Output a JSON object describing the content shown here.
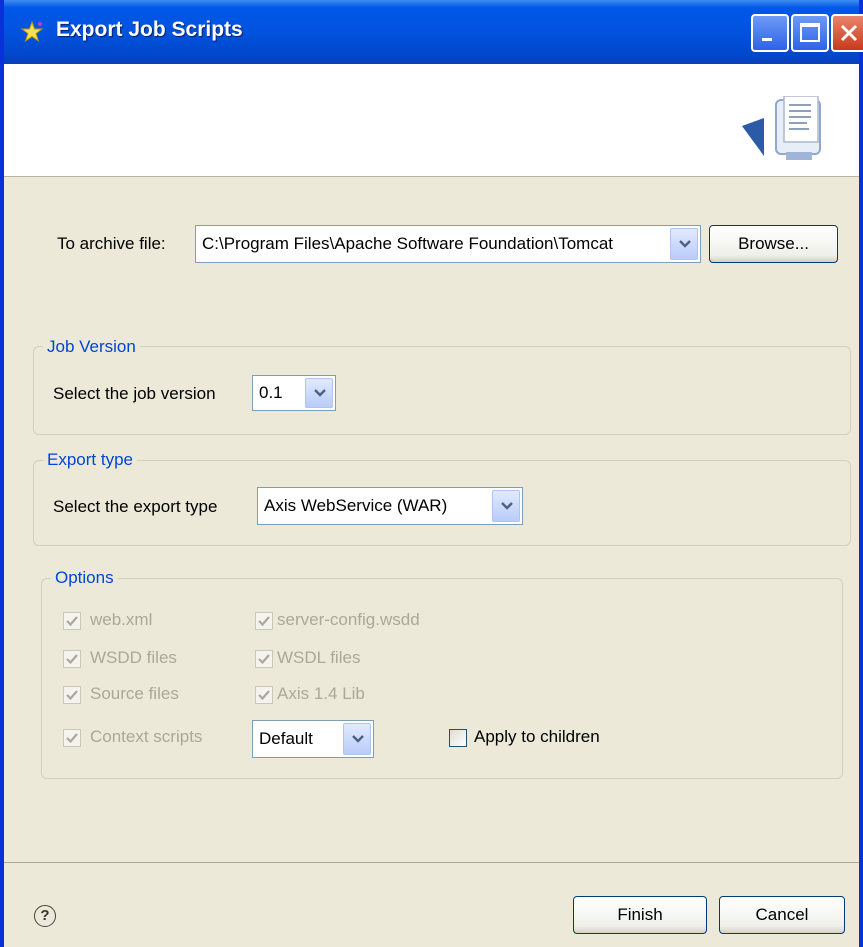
{
  "window": {
    "title": "Export Job Scripts"
  },
  "archive": {
    "label": "To archive file:",
    "value": "C:\\Program Files\\Apache Software Foundation\\Tomcat",
    "browse_label": "Browse..."
  },
  "job_version": {
    "group_title": "Job Version",
    "label": "Select the job version",
    "value": "0.1"
  },
  "export_type": {
    "group_title": "Export type",
    "label": "Select the export type",
    "value": "Axis WebService (WAR)"
  },
  "options": {
    "group_title": "Options",
    "items": [
      {
        "label": "web.xml",
        "checked": true,
        "enabled": false
      },
      {
        "label": "server-config.wsdd",
        "checked": true,
        "enabled": false
      },
      {
        "label": "WSDD files",
        "checked": true,
        "enabled": false
      },
      {
        "label": "WSDL files",
        "checked": true,
        "enabled": false
      },
      {
        "label": "Source files",
        "checked": true,
        "enabled": false
      },
      {
        "label": "Axis 1.4 Lib",
        "checked": true,
        "enabled": false
      },
      {
        "label": "Context scripts",
        "checked": true,
        "enabled": false
      }
    ],
    "context_value": "Default",
    "apply_children_label": "Apply to children",
    "apply_children_checked": false
  },
  "footer": {
    "help_symbol": "?",
    "finish_label": "Finish",
    "cancel_label": "Cancel"
  },
  "colors": {
    "titlebar": "#0154E0",
    "dialog_bg": "#ECE9D8",
    "group_title": "#0046D5",
    "disabled_text": "#ACA899"
  }
}
